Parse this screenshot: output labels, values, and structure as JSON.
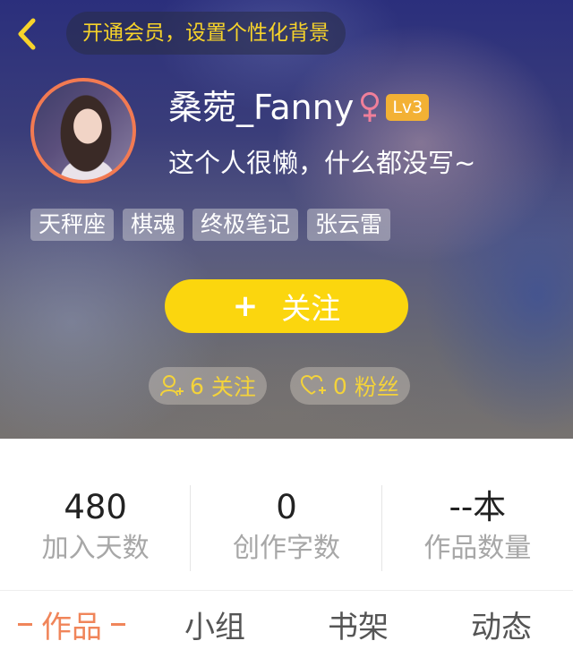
{
  "header": {
    "back_icon": "chevron-left-icon",
    "vip_prompt": "开通会员，设置个性化背景",
    "colors": {
      "accent_yellow": "#fbd60e",
      "avatar_ring": "#f27a52",
      "gender_female": "#f07f9a",
      "level_badge": "#f3b134"
    }
  },
  "profile": {
    "username": "桑菀_Fanny",
    "gender": "female",
    "gender_icon": "female-icon",
    "level": "Lv3",
    "bio": "这个人很懒，什么都没写~",
    "tags": [
      "天秤座",
      "棋魂",
      "终极笔记",
      "张云雷"
    ]
  },
  "actions": {
    "follow_plus": "+",
    "follow_label": "关注",
    "following_count": "6",
    "following_label": "关注",
    "following_icon": "user-plus-icon",
    "followers_count": "0",
    "followers_label": "粉丝",
    "followers_icon": "heart-plus-icon"
  },
  "stats": [
    {
      "value": "480",
      "label": "加入天数"
    },
    {
      "value": "0",
      "label": "创作字数"
    },
    {
      "value": "--本",
      "label": "作品数量"
    }
  ],
  "tabs": [
    {
      "label": "作品",
      "active": true
    },
    {
      "label": "小组",
      "active": false
    },
    {
      "label": "书架",
      "active": false
    },
    {
      "label": "动态",
      "active": false
    }
  ]
}
